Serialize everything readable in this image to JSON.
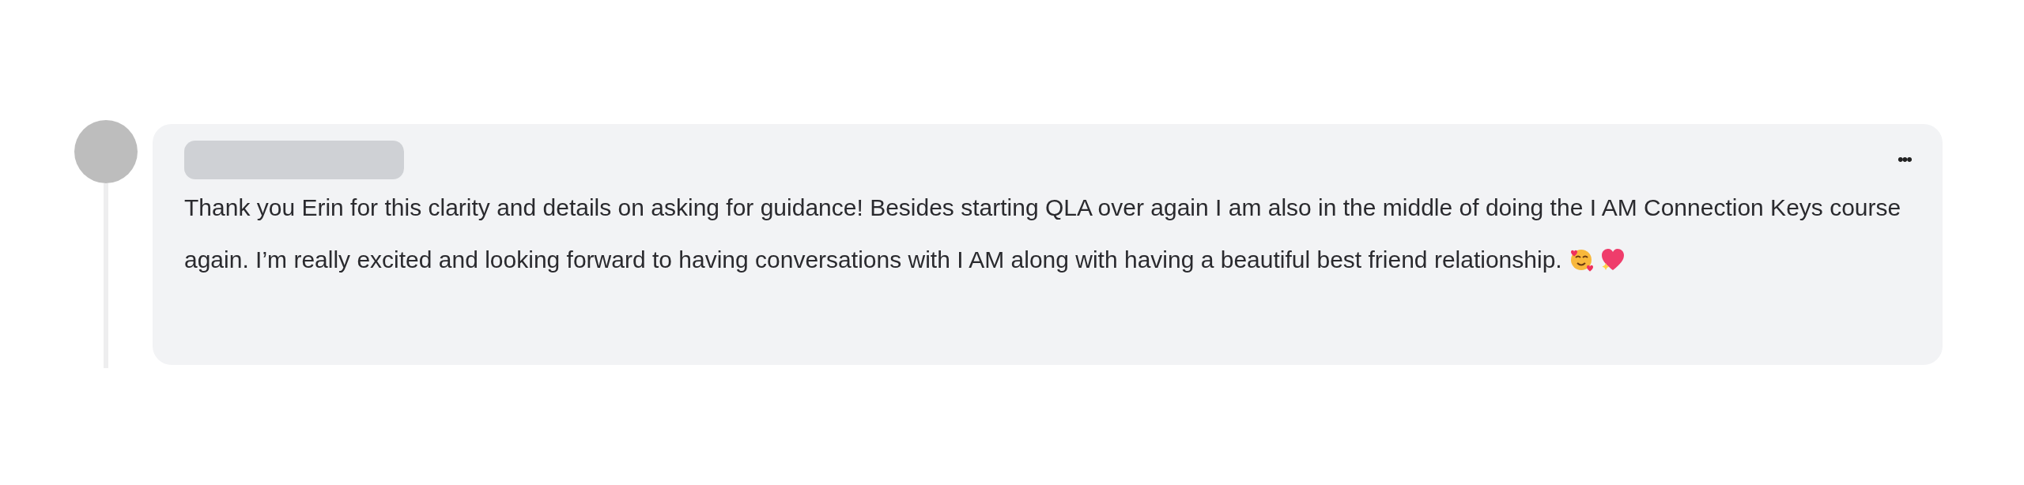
{
  "comment": {
    "text": "Thank you Erin for this clarity and details on asking for guidance! Besides starting QLA over again I am also in the middle of doing the I AM Connection Keys course again. I’m really excited and looking forward to having conversations with I AM along with having a beautiful best friend relationship.",
    "menu_label": "•••"
  }
}
